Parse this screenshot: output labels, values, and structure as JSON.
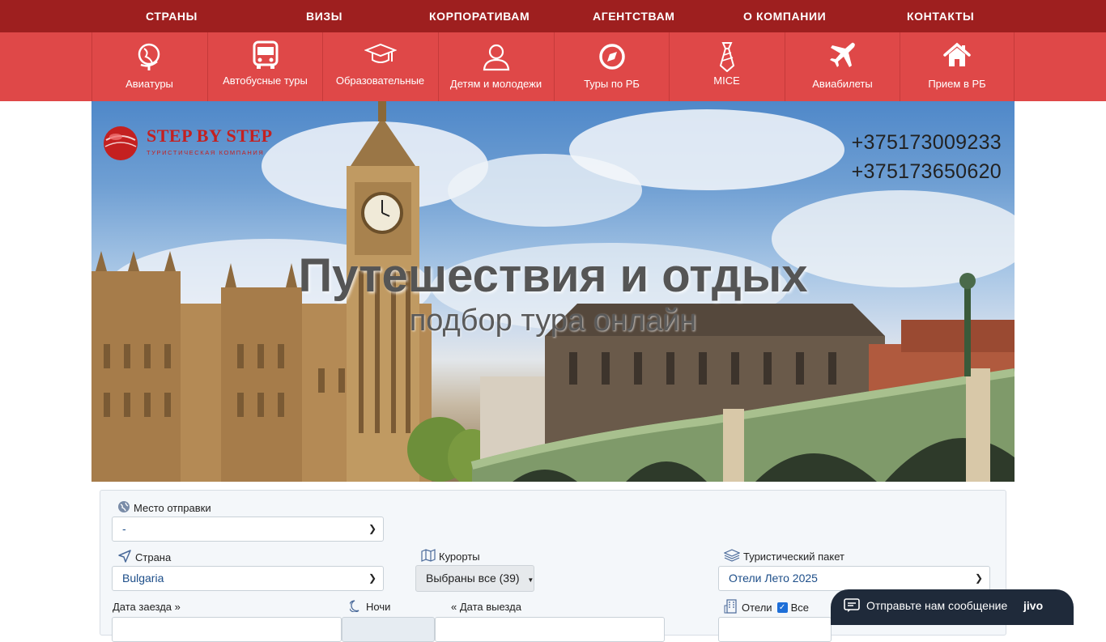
{
  "top_nav": [
    "СТРАНЫ",
    "ВИЗЫ",
    "КОРПОРАТИВАМ",
    "АГЕНТСТВАМ",
    "О КОМПАНИИ",
    "КОНТАКТЫ"
  ],
  "categories": [
    {
      "label": "Авиатуры",
      "icon": "globe-icon"
    },
    {
      "label": "Автобусные туры",
      "icon": "bus-icon"
    },
    {
      "label": "Образовательные",
      "icon": "graduation-cap-icon"
    },
    {
      "label": "Детям и молодежи",
      "icon": "user-icon"
    },
    {
      "label": "Туры по РБ",
      "icon": "compass-icon"
    },
    {
      "label": "MICE",
      "icon": "tie-icon"
    },
    {
      "label": "Авиабилеты",
      "icon": "plane-icon"
    },
    {
      "label": "Прием в РБ",
      "icon": "home-icon"
    }
  ],
  "hero": {
    "logo_text": "STEP BY STEP",
    "logo_sub": "ТУРИСТИЧЕСКАЯ КОМПАНИЯ",
    "phones": [
      "+375173009233",
      "+375173650620"
    ],
    "title": "Путешествия и отдых",
    "subtitle": "подбор тура онлайн"
  },
  "search": {
    "departure_label": "Место отправки",
    "departure_value": "-",
    "country_label": "Страна",
    "country_value": "Bulgaria",
    "resorts_label": "Курорты",
    "resorts_value": "Выбраны все (39)",
    "package_label": "Туристический пакет",
    "package_value": "Отели Лето 2025",
    "checkin_label": "Дата заезда »",
    "nights_label": "Ночи",
    "checkout_label": "« Дата выезда",
    "hotels_label": "Отели",
    "hotels_all_label": "Все"
  },
  "chat": {
    "text": "Отправьте нам сообщение",
    "brand": "jivo"
  },
  "colors": {
    "top_nav_bg": "#9e1f1f",
    "category_bar_bg": "#df4848",
    "link_blue": "#1d4e89"
  }
}
